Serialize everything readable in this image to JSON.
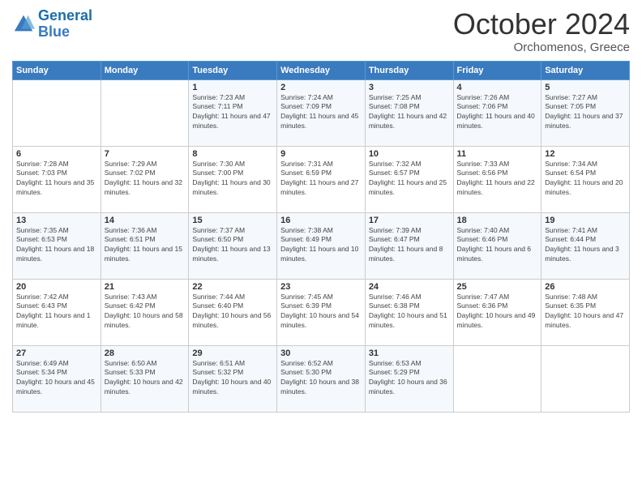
{
  "logo": {
    "line1": "General",
    "line2": "Blue"
  },
  "header": {
    "month": "October 2024",
    "location": "Orchomenos, Greece"
  },
  "weekdays": [
    "Sunday",
    "Monday",
    "Tuesday",
    "Wednesday",
    "Thursday",
    "Friday",
    "Saturday"
  ],
  "weeks": [
    [
      null,
      null,
      {
        "day": 1,
        "sunrise": "7:23 AM",
        "sunset": "7:11 PM",
        "daylight": "11 hours and 47 minutes."
      },
      {
        "day": 2,
        "sunrise": "7:24 AM",
        "sunset": "7:09 PM",
        "daylight": "11 hours and 45 minutes."
      },
      {
        "day": 3,
        "sunrise": "7:25 AM",
        "sunset": "7:08 PM",
        "daylight": "11 hours and 42 minutes."
      },
      {
        "day": 4,
        "sunrise": "7:26 AM",
        "sunset": "7:06 PM",
        "daylight": "11 hours and 40 minutes."
      },
      {
        "day": 5,
        "sunrise": "7:27 AM",
        "sunset": "7:05 PM",
        "daylight": "11 hours and 37 minutes."
      }
    ],
    [
      {
        "day": 6,
        "sunrise": "7:28 AM",
        "sunset": "7:03 PM",
        "daylight": "11 hours and 35 minutes."
      },
      {
        "day": 7,
        "sunrise": "7:29 AM",
        "sunset": "7:02 PM",
        "daylight": "11 hours and 32 minutes."
      },
      {
        "day": 8,
        "sunrise": "7:30 AM",
        "sunset": "7:00 PM",
        "daylight": "11 hours and 30 minutes."
      },
      {
        "day": 9,
        "sunrise": "7:31 AM",
        "sunset": "6:59 PM",
        "daylight": "11 hours and 27 minutes."
      },
      {
        "day": 10,
        "sunrise": "7:32 AM",
        "sunset": "6:57 PM",
        "daylight": "11 hours and 25 minutes."
      },
      {
        "day": 11,
        "sunrise": "7:33 AM",
        "sunset": "6:56 PM",
        "daylight": "11 hours and 22 minutes."
      },
      {
        "day": 12,
        "sunrise": "7:34 AM",
        "sunset": "6:54 PM",
        "daylight": "11 hours and 20 minutes."
      }
    ],
    [
      {
        "day": 13,
        "sunrise": "7:35 AM",
        "sunset": "6:53 PM",
        "daylight": "11 hours and 18 minutes."
      },
      {
        "day": 14,
        "sunrise": "7:36 AM",
        "sunset": "6:51 PM",
        "daylight": "11 hours and 15 minutes."
      },
      {
        "day": 15,
        "sunrise": "7:37 AM",
        "sunset": "6:50 PM",
        "daylight": "11 hours and 13 minutes."
      },
      {
        "day": 16,
        "sunrise": "7:38 AM",
        "sunset": "6:49 PM",
        "daylight": "11 hours and 10 minutes."
      },
      {
        "day": 17,
        "sunrise": "7:39 AM",
        "sunset": "6:47 PM",
        "daylight": "11 hours and 8 minutes."
      },
      {
        "day": 18,
        "sunrise": "7:40 AM",
        "sunset": "6:46 PM",
        "daylight": "11 hours and 6 minutes."
      },
      {
        "day": 19,
        "sunrise": "7:41 AM",
        "sunset": "6:44 PM",
        "daylight": "11 hours and 3 minutes."
      }
    ],
    [
      {
        "day": 20,
        "sunrise": "7:42 AM",
        "sunset": "6:43 PM",
        "daylight": "11 hours and 1 minute."
      },
      {
        "day": 21,
        "sunrise": "7:43 AM",
        "sunset": "6:42 PM",
        "daylight": "10 hours and 58 minutes."
      },
      {
        "day": 22,
        "sunrise": "7:44 AM",
        "sunset": "6:40 PM",
        "daylight": "10 hours and 56 minutes."
      },
      {
        "day": 23,
        "sunrise": "7:45 AM",
        "sunset": "6:39 PM",
        "daylight": "10 hours and 54 minutes."
      },
      {
        "day": 24,
        "sunrise": "7:46 AM",
        "sunset": "6:38 PM",
        "daylight": "10 hours and 51 minutes."
      },
      {
        "day": 25,
        "sunrise": "7:47 AM",
        "sunset": "6:36 PM",
        "daylight": "10 hours and 49 minutes."
      },
      {
        "day": 26,
        "sunrise": "7:48 AM",
        "sunset": "6:35 PM",
        "daylight": "10 hours and 47 minutes."
      }
    ],
    [
      {
        "day": 27,
        "sunrise": "6:49 AM",
        "sunset": "5:34 PM",
        "daylight": "10 hours and 45 minutes."
      },
      {
        "day": 28,
        "sunrise": "6:50 AM",
        "sunset": "5:33 PM",
        "daylight": "10 hours and 42 minutes."
      },
      {
        "day": 29,
        "sunrise": "6:51 AM",
        "sunset": "5:32 PM",
        "daylight": "10 hours and 40 minutes."
      },
      {
        "day": 30,
        "sunrise": "6:52 AM",
        "sunset": "5:30 PM",
        "daylight": "10 hours and 38 minutes."
      },
      {
        "day": 31,
        "sunrise": "6:53 AM",
        "sunset": "5:29 PM",
        "daylight": "10 hours and 36 minutes."
      },
      null,
      null
    ]
  ],
  "labels": {
    "sunrise": "Sunrise:",
    "sunset": "Sunset:",
    "daylight": "Daylight:"
  }
}
